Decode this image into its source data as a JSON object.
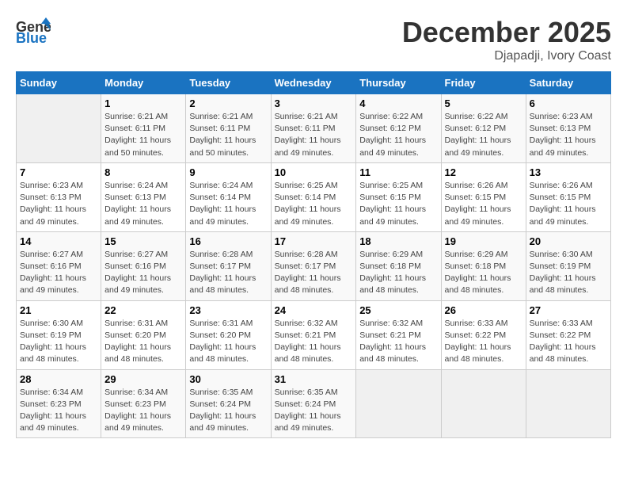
{
  "header": {
    "logo_general": "General",
    "logo_blue": "Blue",
    "month": "December 2025",
    "location": "Djapadji, Ivory Coast"
  },
  "columns": [
    "Sunday",
    "Monday",
    "Tuesday",
    "Wednesday",
    "Thursday",
    "Friday",
    "Saturday"
  ],
  "weeks": [
    [
      {
        "day": "",
        "sunrise": "",
        "sunset": "",
        "daylight": ""
      },
      {
        "day": "1",
        "sunrise": "Sunrise: 6:21 AM",
        "sunset": "Sunset: 6:11 PM",
        "daylight": "Daylight: 11 hours and 50 minutes."
      },
      {
        "day": "2",
        "sunrise": "Sunrise: 6:21 AM",
        "sunset": "Sunset: 6:11 PM",
        "daylight": "Daylight: 11 hours and 50 minutes."
      },
      {
        "day": "3",
        "sunrise": "Sunrise: 6:21 AM",
        "sunset": "Sunset: 6:11 PM",
        "daylight": "Daylight: 11 hours and 49 minutes."
      },
      {
        "day": "4",
        "sunrise": "Sunrise: 6:22 AM",
        "sunset": "Sunset: 6:12 PM",
        "daylight": "Daylight: 11 hours and 49 minutes."
      },
      {
        "day": "5",
        "sunrise": "Sunrise: 6:22 AM",
        "sunset": "Sunset: 6:12 PM",
        "daylight": "Daylight: 11 hours and 49 minutes."
      },
      {
        "day": "6",
        "sunrise": "Sunrise: 6:23 AM",
        "sunset": "Sunset: 6:13 PM",
        "daylight": "Daylight: 11 hours and 49 minutes."
      }
    ],
    [
      {
        "day": "7",
        "sunrise": "Sunrise: 6:23 AM",
        "sunset": "Sunset: 6:13 PM",
        "daylight": "Daylight: 11 hours and 49 minutes."
      },
      {
        "day": "8",
        "sunrise": "Sunrise: 6:24 AM",
        "sunset": "Sunset: 6:13 PM",
        "daylight": "Daylight: 11 hours and 49 minutes."
      },
      {
        "day": "9",
        "sunrise": "Sunrise: 6:24 AM",
        "sunset": "Sunset: 6:14 PM",
        "daylight": "Daylight: 11 hours and 49 minutes."
      },
      {
        "day": "10",
        "sunrise": "Sunrise: 6:25 AM",
        "sunset": "Sunset: 6:14 PM",
        "daylight": "Daylight: 11 hours and 49 minutes."
      },
      {
        "day": "11",
        "sunrise": "Sunrise: 6:25 AM",
        "sunset": "Sunset: 6:15 PM",
        "daylight": "Daylight: 11 hours and 49 minutes."
      },
      {
        "day": "12",
        "sunrise": "Sunrise: 6:26 AM",
        "sunset": "Sunset: 6:15 PM",
        "daylight": "Daylight: 11 hours and 49 minutes."
      },
      {
        "day": "13",
        "sunrise": "Sunrise: 6:26 AM",
        "sunset": "Sunset: 6:15 PM",
        "daylight": "Daylight: 11 hours and 49 minutes."
      }
    ],
    [
      {
        "day": "14",
        "sunrise": "Sunrise: 6:27 AM",
        "sunset": "Sunset: 6:16 PM",
        "daylight": "Daylight: 11 hours and 49 minutes."
      },
      {
        "day": "15",
        "sunrise": "Sunrise: 6:27 AM",
        "sunset": "Sunset: 6:16 PM",
        "daylight": "Daylight: 11 hours and 49 minutes."
      },
      {
        "day": "16",
        "sunrise": "Sunrise: 6:28 AM",
        "sunset": "Sunset: 6:17 PM",
        "daylight": "Daylight: 11 hours and 48 minutes."
      },
      {
        "day": "17",
        "sunrise": "Sunrise: 6:28 AM",
        "sunset": "Sunset: 6:17 PM",
        "daylight": "Daylight: 11 hours and 48 minutes."
      },
      {
        "day": "18",
        "sunrise": "Sunrise: 6:29 AM",
        "sunset": "Sunset: 6:18 PM",
        "daylight": "Daylight: 11 hours and 48 minutes."
      },
      {
        "day": "19",
        "sunrise": "Sunrise: 6:29 AM",
        "sunset": "Sunset: 6:18 PM",
        "daylight": "Daylight: 11 hours and 48 minutes."
      },
      {
        "day": "20",
        "sunrise": "Sunrise: 6:30 AM",
        "sunset": "Sunset: 6:19 PM",
        "daylight": "Daylight: 11 hours and 48 minutes."
      }
    ],
    [
      {
        "day": "21",
        "sunrise": "Sunrise: 6:30 AM",
        "sunset": "Sunset: 6:19 PM",
        "daylight": "Daylight: 11 hours and 48 minutes."
      },
      {
        "day": "22",
        "sunrise": "Sunrise: 6:31 AM",
        "sunset": "Sunset: 6:20 PM",
        "daylight": "Daylight: 11 hours and 48 minutes."
      },
      {
        "day": "23",
        "sunrise": "Sunrise: 6:31 AM",
        "sunset": "Sunset: 6:20 PM",
        "daylight": "Daylight: 11 hours and 48 minutes."
      },
      {
        "day": "24",
        "sunrise": "Sunrise: 6:32 AM",
        "sunset": "Sunset: 6:21 PM",
        "daylight": "Daylight: 11 hours and 48 minutes."
      },
      {
        "day": "25",
        "sunrise": "Sunrise: 6:32 AM",
        "sunset": "Sunset: 6:21 PM",
        "daylight": "Daylight: 11 hours and 48 minutes."
      },
      {
        "day": "26",
        "sunrise": "Sunrise: 6:33 AM",
        "sunset": "Sunset: 6:22 PM",
        "daylight": "Daylight: 11 hours and 48 minutes."
      },
      {
        "day": "27",
        "sunrise": "Sunrise: 6:33 AM",
        "sunset": "Sunset: 6:22 PM",
        "daylight": "Daylight: 11 hours and 48 minutes."
      }
    ],
    [
      {
        "day": "28",
        "sunrise": "Sunrise: 6:34 AM",
        "sunset": "Sunset: 6:23 PM",
        "daylight": "Daylight: 11 hours and 49 minutes."
      },
      {
        "day": "29",
        "sunrise": "Sunrise: 6:34 AM",
        "sunset": "Sunset: 6:23 PM",
        "daylight": "Daylight: 11 hours and 49 minutes."
      },
      {
        "day": "30",
        "sunrise": "Sunrise: 6:35 AM",
        "sunset": "Sunset: 6:24 PM",
        "daylight": "Daylight: 11 hours and 49 minutes."
      },
      {
        "day": "31",
        "sunrise": "Sunrise: 6:35 AM",
        "sunset": "Sunset: 6:24 PM",
        "daylight": "Daylight: 11 hours and 49 minutes."
      },
      {
        "day": "",
        "sunrise": "",
        "sunset": "",
        "daylight": ""
      },
      {
        "day": "",
        "sunrise": "",
        "sunset": "",
        "daylight": ""
      },
      {
        "day": "",
        "sunrise": "",
        "sunset": "",
        "daylight": ""
      }
    ]
  ]
}
